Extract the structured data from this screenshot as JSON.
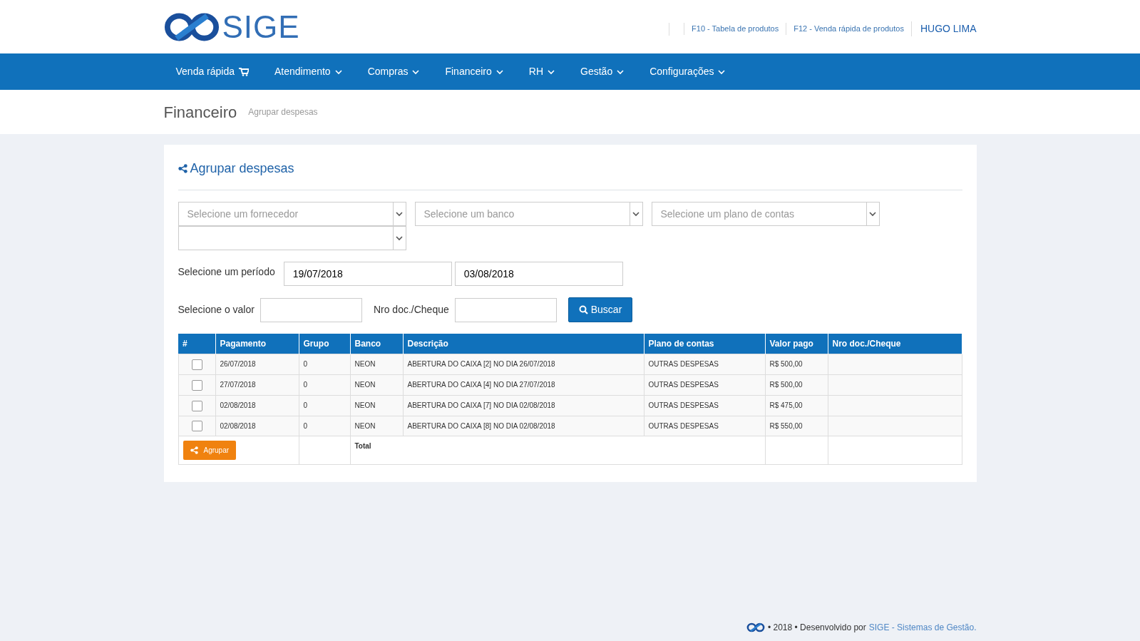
{
  "header": {
    "logo_text": "SIGE",
    "links": [
      "F10 - Tabela de produtos",
      "F12 - Venda rápida de produtos"
    ],
    "user": "HUGO LIMA"
  },
  "nav": [
    {
      "label": "Venda rápida",
      "kind": "cart"
    },
    {
      "label": "Atendimento",
      "kind": "dropdown"
    },
    {
      "label": "Compras",
      "kind": "dropdown"
    },
    {
      "label": "Financeiro",
      "kind": "dropdown"
    },
    {
      "label": "RH",
      "kind": "dropdown"
    },
    {
      "label": "Gestão",
      "kind": "dropdown"
    },
    {
      "label": "Configurações",
      "kind": "dropdown"
    }
  ],
  "breadcrumb": {
    "title": "Financeiro",
    "subtitle": "Agrupar despesas"
  },
  "panel": {
    "title": "Agrupar despesas",
    "selects": [
      {
        "kind": "dropdown",
        "placeholder": "Selecione um fornecedor"
      },
      {
        "kind": "dropdown",
        "placeholder": "Selecione um banco"
      },
      {
        "kind": "dropdown",
        "placeholder": "Selecione um plano de contas"
      },
      {
        "kind": "dropdown"
      }
    ],
    "period": {
      "label": "Selecione um período",
      "from": "19/07/2018",
      "to": "03/08/2018"
    },
    "value_label": "Selecione o valor",
    "doc_label": "Nro doc./Cheque",
    "search_button": "Buscar",
    "table": {
      "columns": [
        "#",
        "Pagamento",
        "Grupo",
        "Banco",
        "Descrição",
        "Plano de contas",
        "Valor pago",
        "Nro doc./Cheque"
      ],
      "rows": [
        {
          "checked": false,
          "cells": [
            "",
            "26/07/2018",
            "0",
            "NEON",
            "ABERTURA DO CAIXA [2] NO DIA 26/07/2018",
            "OUTRAS DESPESAS",
            "R$ 500,00"
          ]
        },
        {
          "checked": false,
          "cells": [
            "",
            "27/07/2018",
            "0",
            "NEON",
            "ABERTURA DO CAIXA [4] NO DIA 27/07/2018",
            "OUTRAS DESPESAS",
            "R$ 500,00"
          ]
        },
        {
          "checked": false,
          "cells": [
            "",
            "02/08/2018",
            "0",
            "NEON",
            "ABERTURA DO CAIXA [7] NO DIA 02/08/2018",
            "OUTRAS DESPESAS",
            "R$ 475,00"
          ]
        },
        {
          "checked": false,
          "cells": [
            "",
            "02/08/2018",
            "0",
            "NEON",
            "ABERTURA DO CAIXA [8] NO DIA 02/08/2018",
            "OUTRAS DESPESAS",
            "R$ 550,00"
          ]
        }
      ],
      "group_button": "Agrupar",
      "total_label": "Total"
    }
  },
  "footer": {
    "text": "• 2018 • Desenvolvido por",
    "link": "SIGE - Sistemas de Gestão."
  }
}
